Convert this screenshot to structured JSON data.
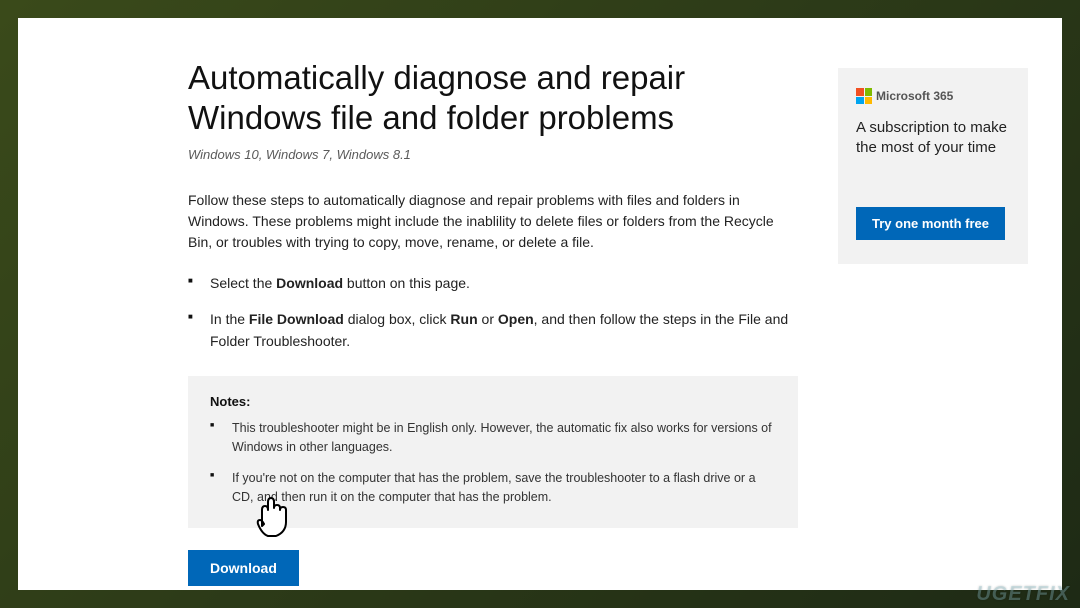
{
  "main": {
    "title": "Automatically diagnose and repair Windows file and folder problems",
    "subtitle": "Windows 10, Windows 7, Windows 8.1",
    "intro": "Follow these steps to automatically diagnose and repair problems with files and folders in Windows. These problems might include the inablility to delete files or folders from the Recycle Bin, or troubles with trying to copy, move, rename, or delete a file.",
    "steps": [
      {
        "pre": "Select the ",
        "b1": "Download",
        "post": " button on this page."
      },
      {
        "pre": "In the ",
        "b1": "File Download",
        "mid1": " dialog box, click ",
        "b2": "Run",
        "mid2": " or ",
        "b3": "Open",
        "post": ", and then follow the steps in the File and Folder Troubleshooter."
      }
    ],
    "notes_title": "Notes:",
    "notes": [
      "This troubleshooter might be in English only. However, the automatic fix also works for versions of Windows in other languages.",
      "If you're not on the computer that has the problem, save the troubleshooter to a flash drive or a CD, and then run it on the computer that has the problem."
    ],
    "download_label": "Download"
  },
  "promo": {
    "brand": "Microsoft 365",
    "text": "A subscription to make the most of your time",
    "cta": "Try one month free"
  },
  "watermark": "UGETFIX"
}
